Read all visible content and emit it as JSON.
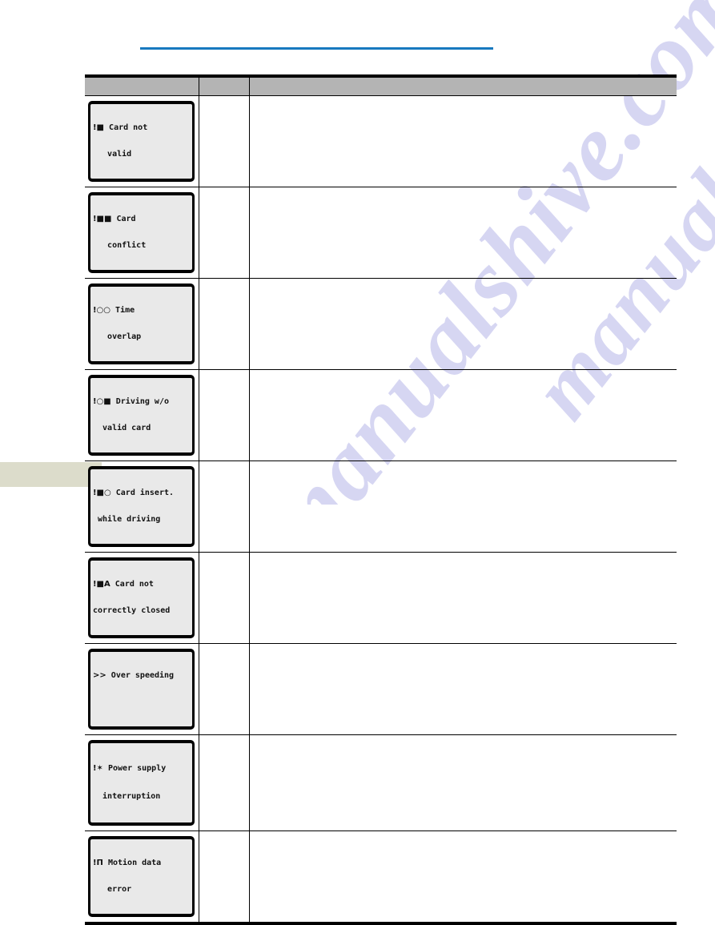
{
  "document": {
    "page_background": "#ffffff",
    "accent_rule_color": "#1879bf",
    "header_fill": "#b4b4b4",
    "footer_block_color": "#dcdccb",
    "watermark_text": "manualshive.com"
  },
  "table": {
    "headers": [
      "",
      "",
      ""
    ],
    "rows": [
      {
        "display": {
          "symbol": "!■",
          "line1": "Card not",
          "line2": "   valid",
          "alt": "Card not valid"
        },
        "col2": "",
        "col3": ""
      },
      {
        "display": {
          "symbol": "!■■",
          "line1": "Card",
          "line2": "   conflict",
          "alt": "Card conflict"
        },
        "col2": "",
        "col3": ""
      },
      {
        "display": {
          "symbol": "!○○",
          "line1": "Time",
          "line2": "   overlap",
          "alt": "Time overlap"
        },
        "col2": "",
        "col3": ""
      },
      {
        "display": {
          "symbol": "!○■",
          "line1": "Driving w/o",
          "line2": "  valid card",
          "alt": "Driving w/o valid card"
        },
        "col2": "",
        "col3": ""
      },
      {
        "display": {
          "symbol": "!■○",
          "line1": "Card insert.",
          "line2": " while driving",
          "alt": "Card insert. while driving"
        },
        "col2": "",
        "col3": ""
      },
      {
        "display": {
          "symbol": "!■A",
          "line1": "Card not",
          "line2": "correctly closed",
          "alt": "Card not correctly closed"
        },
        "col2": "",
        "col3": ""
      },
      {
        "display": {
          "symbol": ">>",
          "line1": "Over speeding",
          "line2": "",
          "alt": "Over speeding"
        },
        "col2": "",
        "col3": ""
      },
      {
        "display": {
          "symbol": "!✶",
          "line1": "Power supply",
          "line2": "  interruption",
          "alt": "Power supply interruption"
        },
        "col2": "",
        "col3": ""
      },
      {
        "display": {
          "symbol": "!Π",
          "line1": "Motion data",
          "line2": "   error",
          "alt": "Motion data error"
        },
        "col2": "",
        "col3": ""
      }
    ]
  }
}
